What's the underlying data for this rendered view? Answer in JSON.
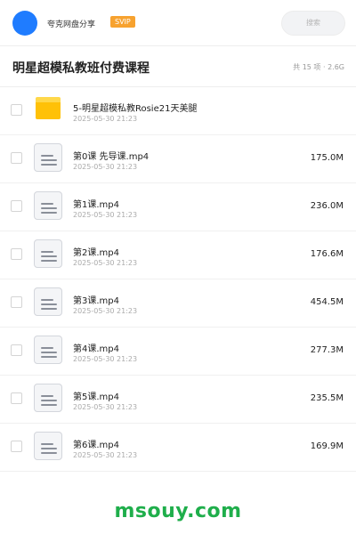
{
  "header": {
    "user_name": "夸克网盘分享",
    "badge": "SVIP",
    "search_placeholder": "搜索"
  },
  "title_bar": {
    "title": "明星超模私教班付费课程",
    "count": "共 15 项 · 2.6G"
  },
  "files": [
    {
      "name": "5-明星超模私教Rosie21天美腿",
      "date": "2025-05-30 21:23",
      "size": "",
      "type": "folder"
    },
    {
      "name": "第0课 先导课.mp4",
      "date": "2025-05-30 21:23",
      "size": "175.0M",
      "type": "file"
    },
    {
      "name": "第1课.mp4",
      "date": "2025-05-30 21:23",
      "size": "236.0M",
      "type": "file"
    },
    {
      "name": "第2课.mp4",
      "date": "2025-05-30 21:23",
      "size": "176.6M",
      "type": "file"
    },
    {
      "name": "第3课.mp4",
      "date": "2025-05-30 21:23",
      "size": "454.5M",
      "type": "file"
    },
    {
      "name": "第4课.mp4",
      "date": "2025-05-30 21:23",
      "size": "277.3M",
      "type": "file"
    },
    {
      "name": "第5课.mp4",
      "date": "2025-05-30 21:23",
      "size": "235.5M",
      "type": "file"
    },
    {
      "name": "第6课.mp4",
      "date": "2025-05-30 21:23",
      "size": "169.9M",
      "type": "file"
    }
  ],
  "watermark": "msouy.com",
  "colors": {
    "avatar": "#1f7cff",
    "svip_badge": "#f7a22f",
    "folder": "#ffc107",
    "watermark": "#1fae4b"
  },
  "icons": {
    "folder": "folder-icon",
    "file": "video-file-icon"
  }
}
